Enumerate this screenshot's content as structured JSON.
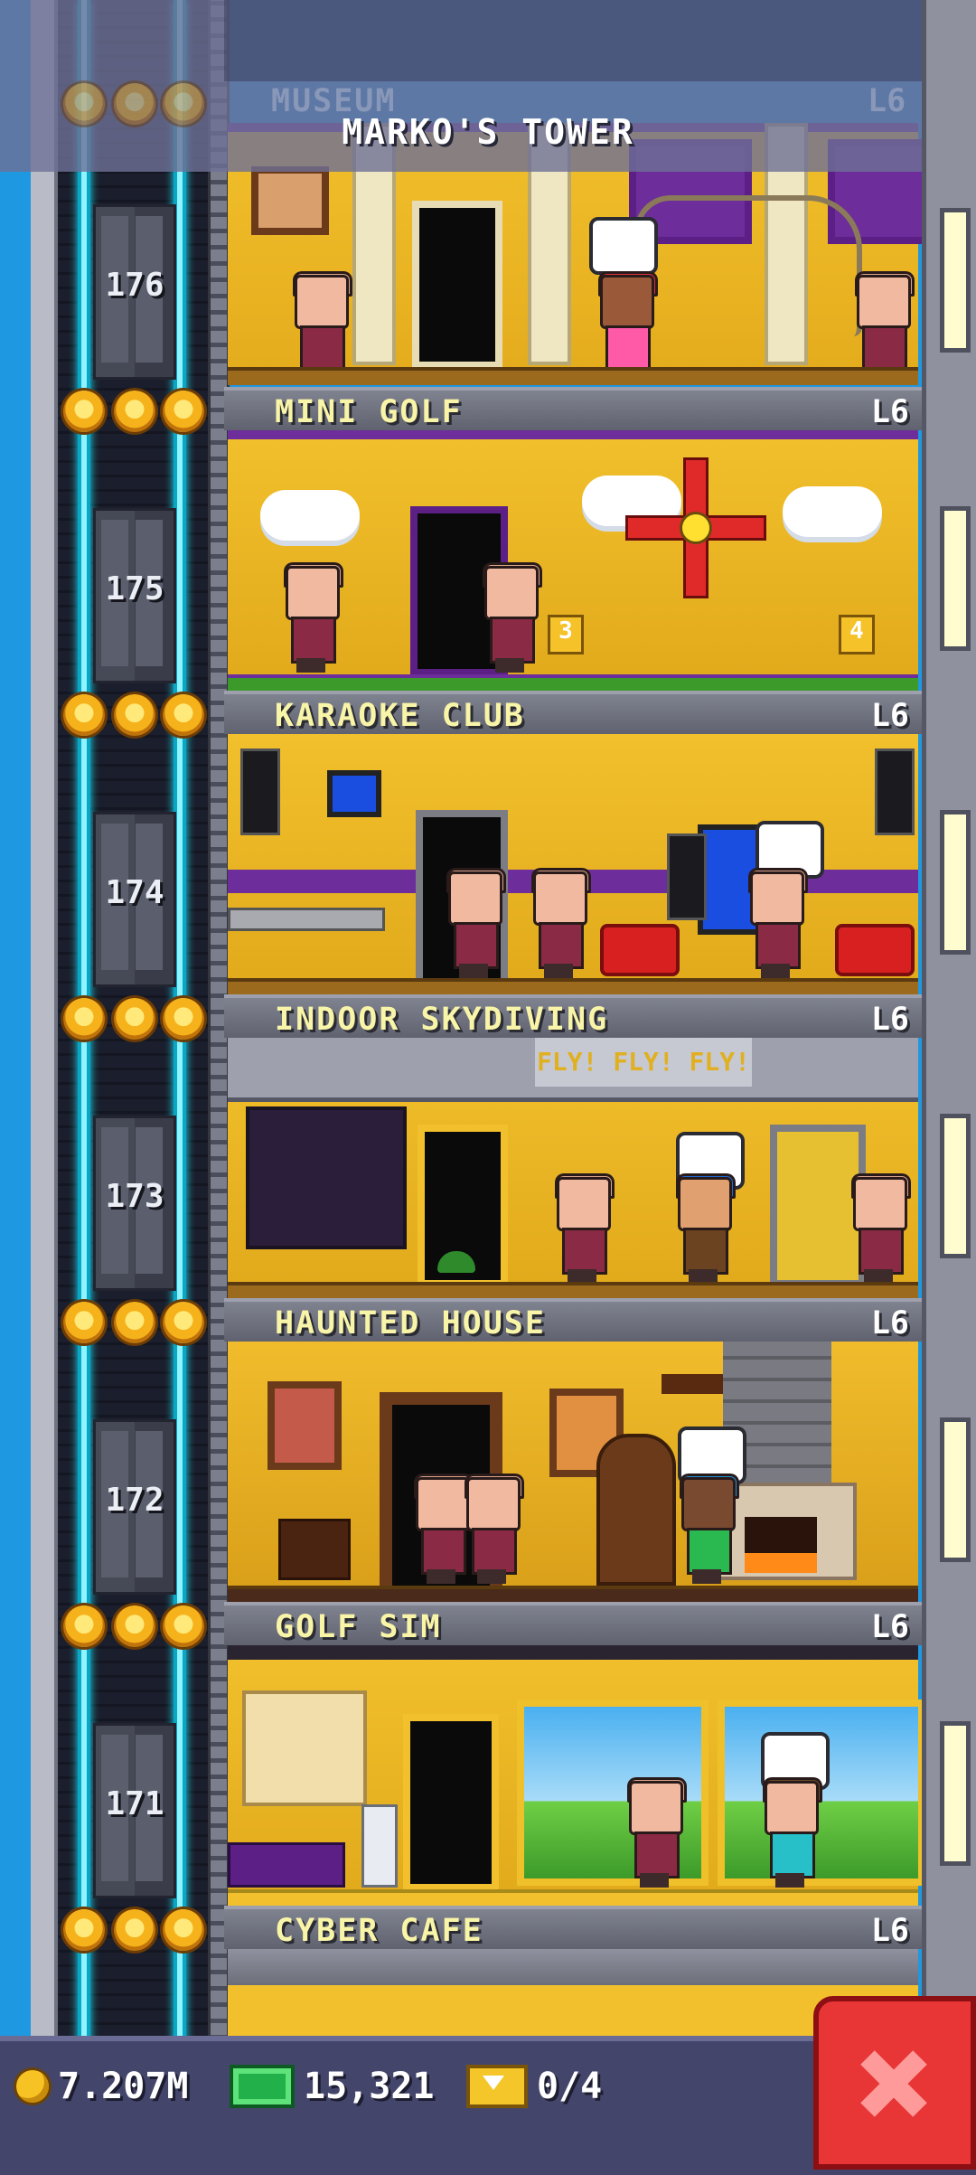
{
  "header": {
    "tower_name": "MARKO'S TOWER",
    "previous_floor": {
      "name": "MUSEUM",
      "level": "L6"
    }
  },
  "floors": [
    {
      "number": "176",
      "name": "MINI GOLF",
      "level": "L6",
      "room_shown": "MUSEUM"
    },
    {
      "number": "175",
      "name": "KARAOKE CLUB",
      "level": "L6",
      "room_shown": "MINI GOLF"
    },
    {
      "number": "174",
      "name": "INDOOR SKYDIVING",
      "level": "L6",
      "room_shown": "KARAOKE CLUB"
    },
    {
      "number": "173",
      "name": "HAUNTED HOUSE",
      "level": "L6",
      "room_shown": "INDOOR SKYDIVING"
    },
    {
      "number": "172",
      "name": "GOLF SIM",
      "level": "L6",
      "room_shown": "HAUNTED HOUSE"
    },
    {
      "number": "171",
      "name": "CYBER CAFE",
      "level": "L6",
      "room_shown": "GOLF SIM"
    }
  ],
  "room_signs": {
    "mini_golf_hole_a": "3",
    "mini_golf_hole_b": "4",
    "skydiving_marquee": "FLY! FLY! FLY!"
  },
  "stats": {
    "coins": "7.207M",
    "bux": "15,321",
    "tickets": "0/4"
  },
  "colors": {
    "sky": "#1e98e0",
    "banner_text": "#f8f4a8",
    "room_yellow": "#f2c02c",
    "close_button": "#e83535",
    "rail_glow": "#18e6ff"
  },
  "icons": [
    "star-icon",
    "coin-icon",
    "bux-icon",
    "ticket-icon",
    "close-icon"
  ]
}
